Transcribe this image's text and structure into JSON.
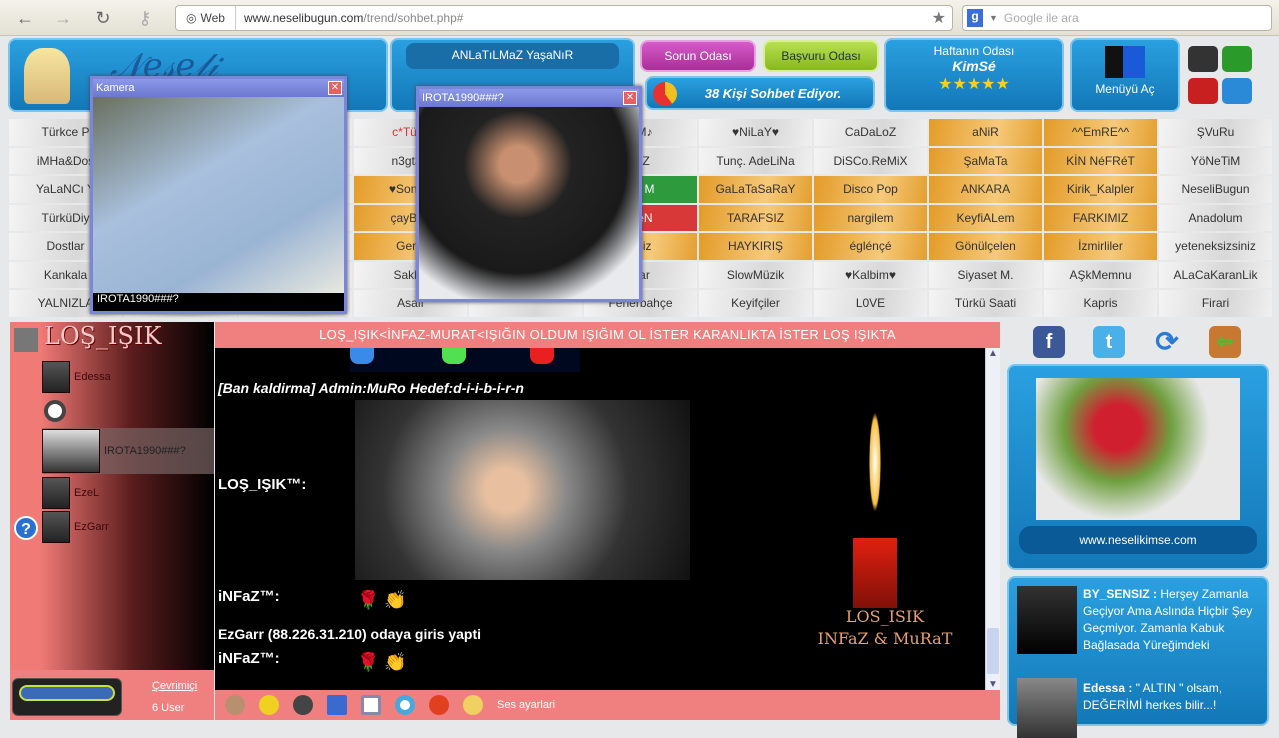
{
  "browser": {
    "web_label": "Web",
    "url_host": "www.neselibugun.com",
    "url_path": "/trend/sohbet.php#",
    "search_placeholder": "Google ile ara"
  },
  "header": {
    "slogan": "ANLaTıLMaZ YaşaNıR",
    "sorun": "Sorun Odası",
    "basvuru": "Başvuru Odası",
    "online_count": "38 Kişi Sohbet Ediyor.",
    "week_title": "Haftanın Odası",
    "week_room": "KimSé",
    "stars": "★★★★★",
    "menu": "Menüyü Aç"
  },
  "rooms": [
    [
      [
        "Türkce P",
        "gray"
      ],
      [
        "",
        "gray"
      ],
      [
        "",
        "gray"
      ],
      [
        "c*TürK",
        "gray"
      ],
      [
        "",
        "gray"
      ],
      [
        "AM♪",
        "gray"
      ],
      [
        "♥NiLaY♥",
        "gray"
      ],
      [
        "CaDaLoZ",
        "gray"
      ],
      [
        "aNiR",
        "orange"
      ],
      [
        "^^EmRE^^",
        "orange"
      ],
      [
        "ŞVuRu",
        "gray"
      ]
    ],
    [
      [
        "iMHa&Dos",
        "gray"
      ],
      [
        "",
        "gray"
      ],
      [
        "",
        "gray"
      ],
      [
        "n3gt3r-",
        "gray"
      ],
      [
        "",
        "gray"
      ],
      [
        "SİZ",
        "gray"
      ],
      [
        "Tunç. AdeLiNa",
        "gray"
      ],
      [
        "DiSCo.ReMiX",
        "gray"
      ],
      [
        "ŞaMaTa",
        "orange"
      ],
      [
        "KİN NéFRéT",
        "orange"
      ],
      [
        "YöNeTiM",
        "gray"
      ]
    ],
    [
      [
        "YaLaNCı Y",
        "gray"
      ],
      [
        "",
        "gray"
      ],
      [
        "",
        "gray"
      ],
      [
        "♥SonSu",
        "orange"
      ],
      [
        "",
        "gray"
      ],
      [
        "ش M",
        "green"
      ],
      [
        "GaLaTaSaRaY",
        "orange"
      ],
      [
        "Disco Pop",
        "orange"
      ],
      [
        "ANKARA",
        "orange"
      ],
      [
        "Kirik_Kalpler",
        "orange"
      ],
      [
        "NeseliBugun",
        "gray"
      ]
    ],
    [
      [
        "TürküDiy",
        "gray"
      ],
      [
        "",
        "gray"
      ],
      [
        "",
        "gray"
      ],
      [
        "çayBah",
        "orange"
      ],
      [
        "",
        "gray"
      ],
      [
        "DeN",
        "red"
      ],
      [
        "TARAFSIZ",
        "orange"
      ],
      [
        "nargilem",
        "orange"
      ],
      [
        "KeyfiALem",
        "orange"
      ],
      [
        "FARKIMIZ",
        "orange"
      ],
      [
        "Anadolum",
        "gray"
      ]
    ],
    [
      [
        "Dostlar",
        "gray"
      ],
      [
        "",
        "gray"
      ],
      [
        "",
        "gray"
      ],
      [
        "GerÇ",
        "orange"
      ],
      [
        "",
        "gray"
      ],
      [
        "eniz",
        "orange"
      ],
      [
        "HAYKIRIŞ",
        "orange"
      ],
      [
        "églénçé",
        "orange"
      ],
      [
        "Gönülçelen",
        "orange"
      ],
      [
        "İzmirliler",
        "orange"
      ],
      [
        "yeteneksizsiniz",
        "gray"
      ]
    ],
    [
      [
        "Kankala",
        "gray"
      ],
      [
        "",
        "gray"
      ],
      [
        "",
        "gray"
      ],
      [
        "Saklar",
        "gray"
      ],
      [
        "",
        "gray"
      ],
      [
        "Bar",
        "gray"
      ],
      [
        "SlowMüzik",
        "gray"
      ],
      [
        "♥Kalbim♥",
        "gray"
      ],
      [
        "Siyaset M.",
        "gray"
      ],
      [
        "AŞkMemnu",
        "gray"
      ],
      [
        "ALaCaKaranLik",
        "gray"
      ]
    ],
    [
      [
        "YALNIZLA",
        "gray"
      ],
      [
        "",
        "gray"
      ],
      [
        "",
        "gray"
      ],
      [
        "Asalı",
        "gray"
      ],
      [
        "",
        "gray"
      ],
      [
        "Fenerbahçe",
        "gray"
      ],
      [
        "Keyifçiler",
        "gray"
      ],
      [
        "L0VE",
        "gray"
      ],
      [
        "Türkü Saati",
        "gray"
      ],
      [
        "Kapris",
        "gray"
      ],
      [
        "Firari",
        "gray"
      ]
    ]
  ],
  "cameras": [
    {
      "title": "Kamera",
      "caption": "IROTA1990###?"
    },
    {
      "title": "IROTA1990###?"
    }
  ],
  "room": {
    "name": "LOŞ_IŞIK",
    "topic": "LOŞ_IŞIK<İNFAZ-MURAT<IŞIĞIN OLDUM IŞIĞIM OL İSTER KARANLIKTA İSTER LOŞ IŞIKTA",
    "online_label": "Çevrimiçi",
    "user_count": "6 User"
  },
  "users": [
    "Edessa",
    "IROTA1990###?",
    "EzeL",
    "EzGarr"
  ],
  "chat": {
    "ban": "[Ban kaldirma] Admin:MuRo Hedef:d-i-i-b-i-r-n",
    "m1": "LOŞ_IŞIK™:",
    "m2": "iNFaZ™:",
    "join": "EzGarr (88.226.31.210) odaya giris yapti",
    "m3": "iNFaZ™:",
    "candle1": "LOS_ISIK",
    "candle2": "INFaZ & MuRaT"
  },
  "toolbar": {
    "sound": "Ses ayarlari"
  },
  "right": {
    "site": "www.neselikimse.com",
    "feed": [
      {
        "user": "BY_SENSIZ :",
        "text": "Herşey Zamanla Geçiyor Ama Aslında Hiçbir Şey Geçmiyor. Zamanla Kabuk Bağlasada Yüreğimdeki"
      },
      {
        "user": "Edessa :",
        "text": "\" ALTIN \" olsam, DEĞERİMİ herkes bilir...!"
      }
    ]
  }
}
